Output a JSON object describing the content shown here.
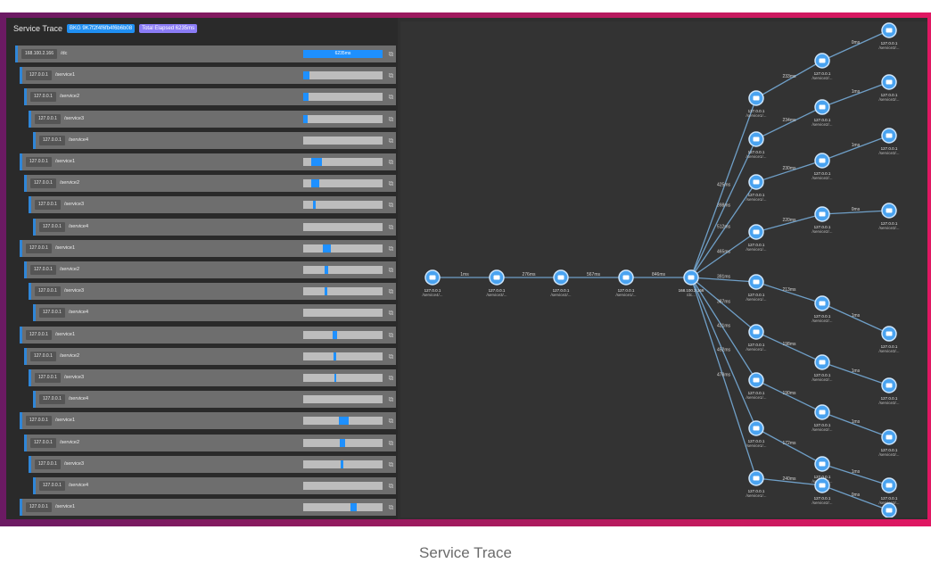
{
  "header": {
    "title": "Service Trace",
    "trace_id": "BKG 9K7f2f4f6fb4f6b6b08",
    "elapsed": "Total Elapsed 6235ms"
  },
  "colors": {
    "accent": "#1f8ff2",
    "badge_purple": "#8b7cf6",
    "row_accent": "#2f86d8",
    "node": "#4aa3f0"
  },
  "rows": [
    {
      "ip": "168.100.2.166",
      "path": "/dc",
      "depth": 0,
      "start": 0.0,
      "width": 1.0,
      "label": "6235ms"
    },
    {
      "ip": "127.0.0.1",
      "path": "/service1",
      "depth": 1,
      "start": 0.0,
      "width": 0.08,
      "label": ""
    },
    {
      "ip": "127.0.0.1",
      "path": "/service2",
      "depth": 2,
      "start": 0.0,
      "width": 0.07,
      "label": ""
    },
    {
      "ip": "127.0.0.1",
      "path": "/service3",
      "depth": 3,
      "start": 0.0,
      "width": 0.06,
      "label": ""
    },
    {
      "ip": "127.0.0.1",
      "path": "/service4",
      "depth": 4,
      "start": 0.0,
      "width": 0.0,
      "label": ""
    },
    {
      "ip": "127.0.0.1",
      "path": "/service1",
      "depth": 1,
      "start": 0.1,
      "width": 0.14,
      "label": ""
    },
    {
      "ip": "127.0.0.1",
      "path": "/service2",
      "depth": 2,
      "start": 0.1,
      "width": 0.1,
      "label": ""
    },
    {
      "ip": "127.0.0.1",
      "path": "/service3",
      "depth": 3,
      "start": 0.12,
      "width": 0.04,
      "label": ""
    },
    {
      "ip": "127.0.0.1",
      "path": "/service4",
      "depth": 4,
      "start": 0.0,
      "width": 0.0,
      "label": ""
    },
    {
      "ip": "127.0.0.1",
      "path": "/service1",
      "depth": 1,
      "start": 0.25,
      "width": 0.1,
      "label": ""
    },
    {
      "ip": "127.0.0.1",
      "path": "/service2",
      "depth": 2,
      "start": 0.27,
      "width": 0.04,
      "label": ""
    },
    {
      "ip": "127.0.0.1",
      "path": "/service3",
      "depth": 3,
      "start": 0.27,
      "width": 0.03,
      "label": ""
    },
    {
      "ip": "127.0.0.1",
      "path": "/service4",
      "depth": 4,
      "start": 0.0,
      "width": 0.0,
      "label": ""
    },
    {
      "ip": "127.0.0.1",
      "path": "/service1",
      "depth": 1,
      "start": 0.37,
      "width": 0.06,
      "label": ""
    },
    {
      "ip": "127.0.0.1",
      "path": "/service2",
      "depth": 2,
      "start": 0.38,
      "width": 0.04,
      "label": ""
    },
    {
      "ip": "127.0.0.1",
      "path": "/service3",
      "depth": 3,
      "start": 0.39,
      "width": 0.03,
      "label": ""
    },
    {
      "ip": "127.0.0.1",
      "path": "/service4",
      "depth": 4,
      "start": 0.0,
      "width": 0.0,
      "label": ""
    },
    {
      "ip": "127.0.0.1",
      "path": "/service1",
      "depth": 1,
      "start": 0.45,
      "width": 0.12,
      "label": ""
    },
    {
      "ip": "127.0.0.1",
      "path": "/service2",
      "depth": 2,
      "start": 0.46,
      "width": 0.07,
      "label": ""
    },
    {
      "ip": "127.0.0.1",
      "path": "/service3",
      "depth": 3,
      "start": 0.47,
      "width": 0.04,
      "label": ""
    },
    {
      "ip": "127.0.0.1",
      "path": "/service4",
      "depth": 4,
      "start": 0.0,
      "width": 0.0,
      "label": ""
    },
    {
      "ip": "127.0.0.1",
      "path": "/service1",
      "depth": 1,
      "start": 0.6,
      "width": 0.07,
      "label": ""
    }
  ],
  "graph": {
    "nodes": [
      {
        "id": "c1",
        "l1": "127.0.0.1",
        "l2": "/service4/..."
      },
      {
        "id": "c2",
        "l1": "127.0.0.1",
        "l2": "/service3/..."
      },
      {
        "id": "c3",
        "l1": "127.0.0.1",
        "l2": "/service2/..."
      },
      {
        "id": "c4",
        "l1": "127.0.0.1",
        "l2": "/service1/..."
      },
      {
        "id": "root",
        "l1": "168.100.2.166",
        "l2": "/dc..."
      },
      {
        "id": "a1",
        "l1": "127.0.0.1",
        "l2": "/service1/..."
      },
      {
        "id": "a2",
        "l1": "127.0.0.1",
        "l2": "/service1/..."
      },
      {
        "id": "a3",
        "l1": "127.0.0.1",
        "l2": "/service1/..."
      },
      {
        "id": "a4",
        "l1": "127.0.0.1",
        "l2": "/service1/..."
      },
      {
        "id": "a5",
        "l1": "127.0.0.1",
        "l2": "/service1/..."
      },
      {
        "id": "a6",
        "l1": "127.0.0.1",
        "l2": "/service1/..."
      },
      {
        "id": "a7",
        "l1": "127.0.0.1",
        "l2": "/service1/..."
      },
      {
        "id": "a8",
        "l1": "127.0.0.1",
        "l2": "/service1/..."
      },
      {
        "id": "a9",
        "l1": "127.0.0.1",
        "l2": "/service1/..."
      },
      {
        "id": "b1",
        "l1": "127.0.0.1",
        "l2": "/service2/..."
      },
      {
        "id": "b2",
        "l1": "127.0.0.1",
        "l2": "/service2/..."
      },
      {
        "id": "b3",
        "l1": "127.0.0.1",
        "l2": "/service2/..."
      },
      {
        "id": "b4",
        "l1": "127.0.0.1",
        "l2": "/service2/..."
      },
      {
        "id": "b5",
        "l1": "127.0.0.1",
        "l2": "/service2/..."
      },
      {
        "id": "b6",
        "l1": "127.0.0.1",
        "l2": "/service2/..."
      },
      {
        "id": "b7",
        "l1": "127.0.0.1",
        "l2": "/service2/..."
      },
      {
        "id": "b8",
        "l1": "127.0.0.1",
        "l2": "/service2/..."
      },
      {
        "id": "b9",
        "l1": "127.0.0.1",
        "l2": "/service2/..."
      },
      {
        "id": "d1",
        "l1": "127.0.0.1",
        "l2": "/service3/..."
      },
      {
        "id": "d2",
        "l1": "127.0.0.1",
        "l2": "/service3/..."
      },
      {
        "id": "d3",
        "l1": "127.0.0.1",
        "l2": "/service3/..."
      },
      {
        "id": "d4",
        "l1": "127.0.0.1",
        "l2": "/service3/..."
      },
      {
        "id": "d5",
        "l1": "127.0.0.1",
        "l2": "/service3/..."
      },
      {
        "id": "d6",
        "l1": "127.0.0.1",
        "l2": "/service3/..."
      },
      {
        "id": "d7",
        "l1": "127.0.0.1",
        "l2": "/service3/..."
      },
      {
        "id": "d8",
        "l1": "127.0.0.1",
        "l2": "/service3/..."
      },
      {
        "id": "d9",
        "l1": "127.0.0.1",
        "l2": "/service3/..."
      }
    ],
    "edges": [
      {
        "from": "c1",
        "to": "c2",
        "label": "1ms"
      },
      {
        "from": "c2",
        "to": "c3",
        "label": "276ms"
      },
      {
        "from": "c3",
        "to": "c4",
        "label": "567ms"
      },
      {
        "from": "c4",
        "to": "root",
        "label": "846ms"
      },
      {
        "from": "root",
        "to": "a1",
        "label": "425ms"
      },
      {
        "from": "root",
        "to": "a2",
        "label": "398ms"
      },
      {
        "from": "root",
        "to": "a3",
        "label": "512ms"
      },
      {
        "from": "root",
        "to": "a4",
        "label": "465ms"
      },
      {
        "from": "root",
        "to": "a5",
        "label": "391ms"
      },
      {
        "from": "root",
        "to": "a6",
        "label": "387ms"
      },
      {
        "from": "root",
        "to": "a7",
        "label": "421ms"
      },
      {
        "from": "root",
        "to": "a8",
        "label": "452ms"
      },
      {
        "from": "root",
        "to": "a9",
        "label": "478ms"
      },
      {
        "from": "a1",
        "to": "b1",
        "label": "233ms"
      },
      {
        "from": "a2",
        "to": "b2",
        "label": "234ms"
      },
      {
        "from": "a3",
        "to": "b3",
        "label": "230ms"
      },
      {
        "from": "a4",
        "to": "b4",
        "label": "220ms"
      },
      {
        "from": "a5",
        "to": "b5",
        "label": "213ms"
      },
      {
        "from": "a6",
        "to": "b6",
        "label": "198ms"
      },
      {
        "from": "a7",
        "to": "b7",
        "label": "190ms"
      },
      {
        "from": "a8",
        "to": "b8",
        "label": "172ms"
      },
      {
        "from": "a9",
        "to": "b9",
        "label": "240ms"
      },
      {
        "from": "b1",
        "to": "d1",
        "label": "0ms"
      },
      {
        "from": "b2",
        "to": "d2",
        "label": "1ms"
      },
      {
        "from": "b3",
        "to": "d3",
        "label": "1ms"
      },
      {
        "from": "b4",
        "to": "d4",
        "label": "0ms"
      },
      {
        "from": "b5",
        "to": "d5",
        "label": "1ms"
      },
      {
        "from": "b6",
        "to": "d6",
        "label": "1ms"
      },
      {
        "from": "b7",
        "to": "d7",
        "label": "1ms"
      },
      {
        "from": "b8",
        "to": "d8",
        "label": "1ms"
      },
      {
        "from": "b9",
        "to": "d9",
        "label": "0ms"
      }
    ]
  },
  "caption": "Service Trace"
}
